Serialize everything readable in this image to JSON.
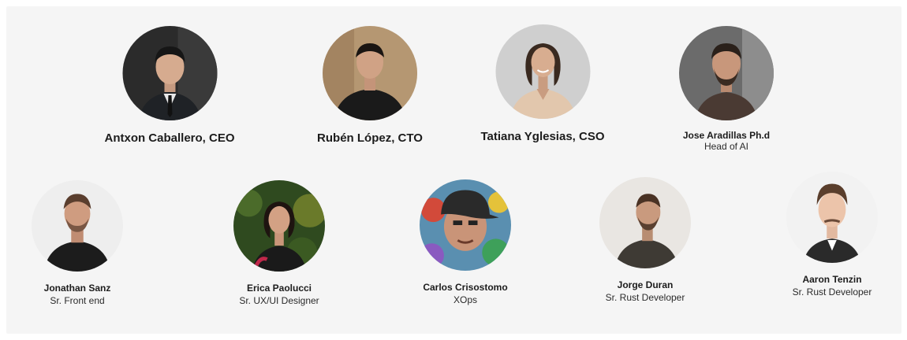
{
  "team": {
    "leaders": [
      {
        "name": "Antxon Caballero, CEO",
        "role": "",
        "avatar_icon": "person-avatar-icon"
      },
      {
        "name": "Rubén López, CTO",
        "role": "",
        "avatar_icon": "person-avatar-icon"
      },
      {
        "name": "Tatiana Yglesias, CSO",
        "role": "",
        "avatar_icon": "person-avatar-icon"
      },
      {
        "name": "Jose Aradillas Ph.d",
        "role": "Head of AI",
        "avatar_icon": "person-avatar-icon"
      }
    ],
    "members": [
      {
        "name": "Jonathan Sanz",
        "role": "Sr. Front end",
        "avatar_icon": "person-avatar-icon"
      },
      {
        "name": "Erica Paolucci",
        "role": "Sr. UX/UI Designer",
        "avatar_icon": "person-avatar-icon"
      },
      {
        "name": "Carlos Crisostomo",
        "role": "XOps",
        "avatar_icon": "person-avatar-icon"
      },
      {
        "name": "Jorge Duran",
        "role": "Sr. Rust Developer",
        "avatar_icon": "person-avatar-icon"
      },
      {
        "name": "Aaron Tenzin",
        "role": "Sr. Rust Developer",
        "avatar_icon": "person-avatar-icon"
      }
    ]
  }
}
